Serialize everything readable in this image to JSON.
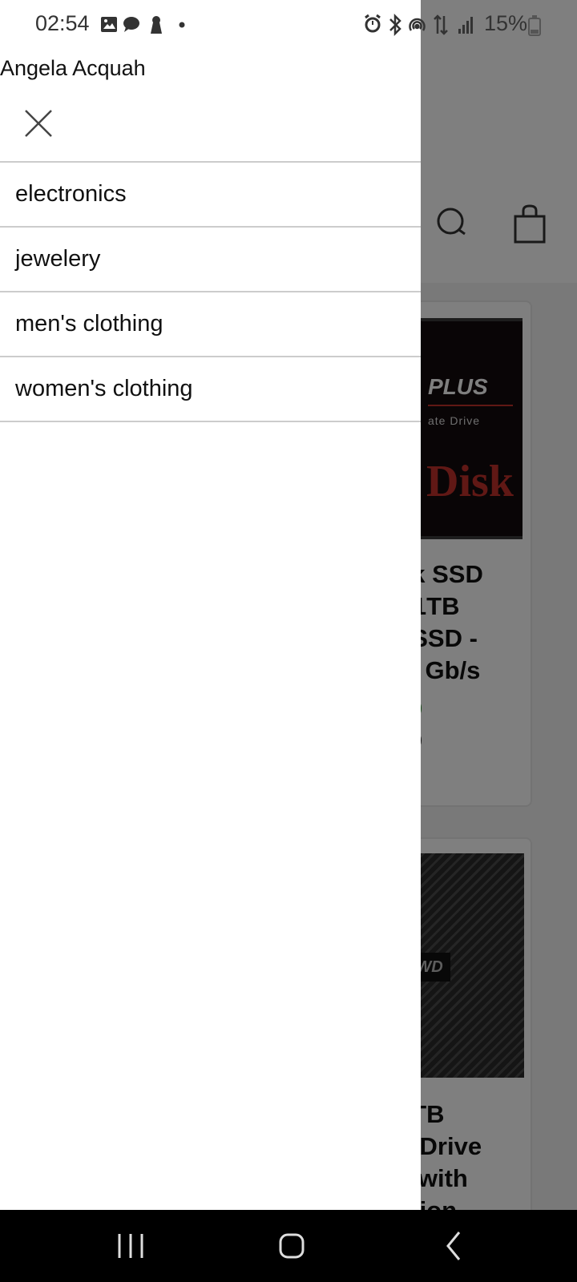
{
  "status_bar": {
    "time": "02:54",
    "battery": "15%"
  },
  "drawer": {
    "user_name": "Angela Acquah",
    "categories": [
      "electronics",
      "jewelery",
      "men's clothing",
      "women's clothing"
    ]
  },
  "background": {
    "products": [
      {
        "image_text": {
          "plus": "PLUS",
          "subtitle": "ate Drive",
          "brand": "Disk"
        },
        "title_visible": "sk SSD\n; 1TB\nl SSD -\n 6 Gb/s",
        "price_visible": "09"
      },
      {
        "image_text": {
          "badge": "WD"
        },
        "title_visible": "4TB\ng Drive\ns with\nation"
      }
    ]
  },
  "colors": {
    "price": "#0a7a0a",
    "scrim": "rgba(0,0,0,0.5)",
    "divider": "#cccccc"
  }
}
